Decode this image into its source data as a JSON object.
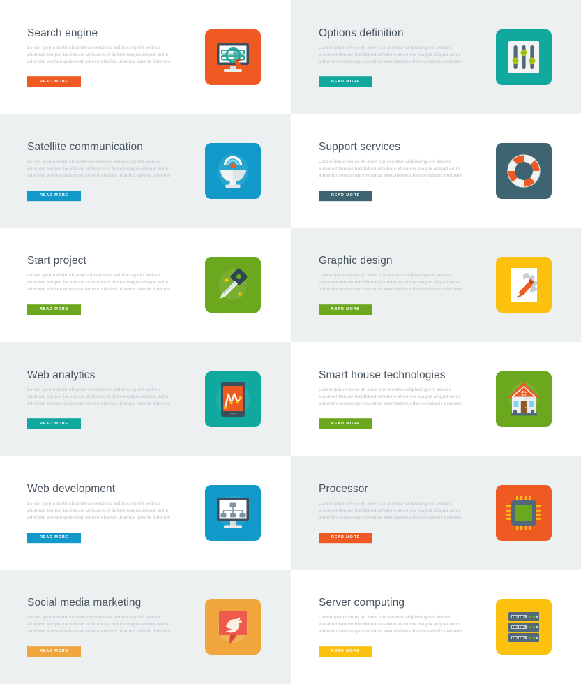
{
  "common": {
    "description": "Lorem ipsum dolor sit amet consectetur adipiscing elit sedrso eiusmod tempor incididunt ut labore et dolore magna aliquat enim adminim veniam quis nostrud exercitation ullamco laboris dolorem",
    "button_label": "READ MORE"
  },
  "palette": {
    "bg_white": "#ffffff",
    "bg_gray": "#edf0f0",
    "title_color": "#48545f",
    "desc_color": "#c7cfd2",
    "orange": "#ef5a22",
    "teal": "#11a8a0",
    "blue": "#119ac9",
    "slate": "#3d6470",
    "green": "#6ba81e",
    "yellow": "#fcc10e",
    "amber": "#f0a63c"
  },
  "cards": [
    {
      "id": "search-engine",
      "title": "Search engine",
      "description": "Lorem ipsum dolor sit amet consectetur adipiscing elit sedrso eiusmod tempor incididunt ut labore et dolore magna aliquat enim adminim veniam quis nostrud exercitation ullamco laboris dolorem",
      "button_label": "READ MORE",
      "accent": "#ef5a22",
      "tile_color": "#ef5a22",
      "background": "#ffffff",
      "icon": "monitor-search-icon",
      "column": "left",
      "row": 1
    },
    {
      "id": "options-definition",
      "title": "Options definition",
      "description": "Lorem ipsum dolor sit amet consectetur adipiscing elit sedrso eiusmod tempor incididunt ut labore et dolore magna aliquat enim adminim veniam quis nostrud exercitation ullamco laboris dolorem",
      "button_label": "READ MORE",
      "accent": "#11a8a0",
      "tile_color": "#11a8a0",
      "background": "#edf0f0",
      "icon": "sliders-icon",
      "column": "right",
      "row": 1
    },
    {
      "id": "satellite-communication",
      "title": "Satellite communication",
      "description": "Lorem ipsum dolor sit amet consectetur adipiscing elit sedrso eiusmod tempor incididunt ut labore et dolore magna aliquat enim adminim veniam quis nostrud exercitation ullamco laboris dolorem",
      "button_label": "READ MORE",
      "accent": "#119ac9",
      "tile_color": "#119ac9",
      "background": "#edf0f0",
      "icon": "satellite-dish-icon",
      "column": "left",
      "row": 2
    },
    {
      "id": "support-services",
      "title": "Support services",
      "description": "Lorem ipsum dolor sit amet consectetur adipiscing elit sedrso eiusmod tempor incididunt ut labore et dolore magna aliquat enim adminim veniam quis nostrud exercitation ullamco laboris dolorem",
      "button_label": "READ MORE",
      "accent": "#3d6470",
      "tile_color": "#3d6470",
      "background": "#ffffff",
      "icon": "lifebuoy-icon",
      "column": "right",
      "row": 2
    },
    {
      "id": "start-project",
      "title": "Start project",
      "description": "Lorem ipsum dolor sit amet consectetur adipiscing elit sedrso eiusmod tempor incididunt ut labore et dolore magna aliquat enim adminim veniam quis nostrud exercitation ullamco laboris dolorem",
      "button_label": "READ MORE",
      "accent": "#6ba81e",
      "tile_color": "#6ba81e",
      "background": "#ffffff",
      "icon": "key-icon",
      "column": "left",
      "row": 3
    },
    {
      "id": "graphic-design",
      "title": "Graphic design",
      "description": "Lorem ipsum dolor sit amet consectetur adipiscing elit sedrso eiusmod tempor incididunt ut labore et dolore magna aliquat enim adminim veniam quis nostrud exercitation ullamco laboris dolorem",
      "button_label": "READ MORE",
      "accent": "#6ba81e",
      "tile_color": "#fcc10e",
      "background": "#edf0f0",
      "icon": "gear-pencil-icon",
      "column": "right",
      "row": 3
    },
    {
      "id": "web-analytics",
      "title": "Web analytics",
      "description": "Lorem ipsum dolor sit amet consectetur adipiscing elit sedrso eiusmod tempor incididunt ut labore et dolore magna aliquat enim adminim veniam quis nostrud exercitation ullamco laboris dolorem",
      "button_label": "READ MORE",
      "accent": "#11a8a0",
      "tile_color": "#11a8a0",
      "background": "#edf0f0",
      "icon": "tablet-chart-icon",
      "column": "left",
      "row": 4
    },
    {
      "id": "smart-house-technologies",
      "title": "Smart house technologies",
      "description": "Lorem ipsum dolor sit amet consectetur adipiscing elit sedrso eiusmod tempor incididunt ut labore et dolore magna aliquat enim adminim veniam quis nostrud exercitation ullamco laboris dolorem",
      "button_label": "READ MORE",
      "accent": "#6ba81e",
      "tile_color": "#6ba81e",
      "background": "#ffffff",
      "icon": "house-icon",
      "column": "right",
      "row": 4
    },
    {
      "id": "web-development",
      "title": "Web development",
      "description": "Lorem ipsum dolor sit amet consectetur adipiscing elit sedrso eiusmod tempor incididunt ut labore et dolore magna aliquat enim adminim veniam quis nostrud exercitation ullamco laboris dolorem",
      "button_label": "READ MORE",
      "accent": "#119ac9",
      "tile_color": "#119ac9",
      "background": "#ffffff",
      "icon": "sitemap-monitor-icon",
      "column": "left",
      "row": 5
    },
    {
      "id": "processor",
      "title": "Processor",
      "description": "Lorem ipsum dolor sit amet consectetur adipiscing elit sedrso eiusmod tempor incididunt ut labore et dolore magna aliquat enim adminim veniam quis nostrud exercitation ullamco laboris dolorem",
      "button_label": "READ MORE",
      "accent": "#ef5a22",
      "tile_color": "#ef5a22",
      "background": "#edf0f0",
      "icon": "cpu-chip-icon",
      "column": "right",
      "row": 5
    },
    {
      "id": "social-media-marketing",
      "title": "Social media marketing",
      "description": "Lorem ipsum dolor sit amet consectetur adipiscing elit sedrso eiusmod tempor incididunt ut labore et dolore magna aliquat enim adminim veniam quis nostrud exercitation ullamco laboris dolorem",
      "button_label": "READ MORE",
      "accent": "#f0a63c",
      "tile_color": "#f0a63c",
      "background": "#edf0f0",
      "icon": "bird-speech-bubble-icon",
      "column": "left",
      "row": 6
    },
    {
      "id": "server-computing",
      "title": "Server computing",
      "description": "Lorem ipsum dolor sit amet consectetur adipiscing elit sedrso eiusmod tempor incididunt ut labore et dolore magna aliquat enim adminim veniam quis nostrud exercitation ullamco laboris dolorem",
      "button_label": "READ MORE",
      "accent": "#fcc10e",
      "tile_color": "#fcc10e",
      "background": "#ffffff",
      "icon": "server-rack-icon",
      "column": "right",
      "row": 6
    }
  ]
}
